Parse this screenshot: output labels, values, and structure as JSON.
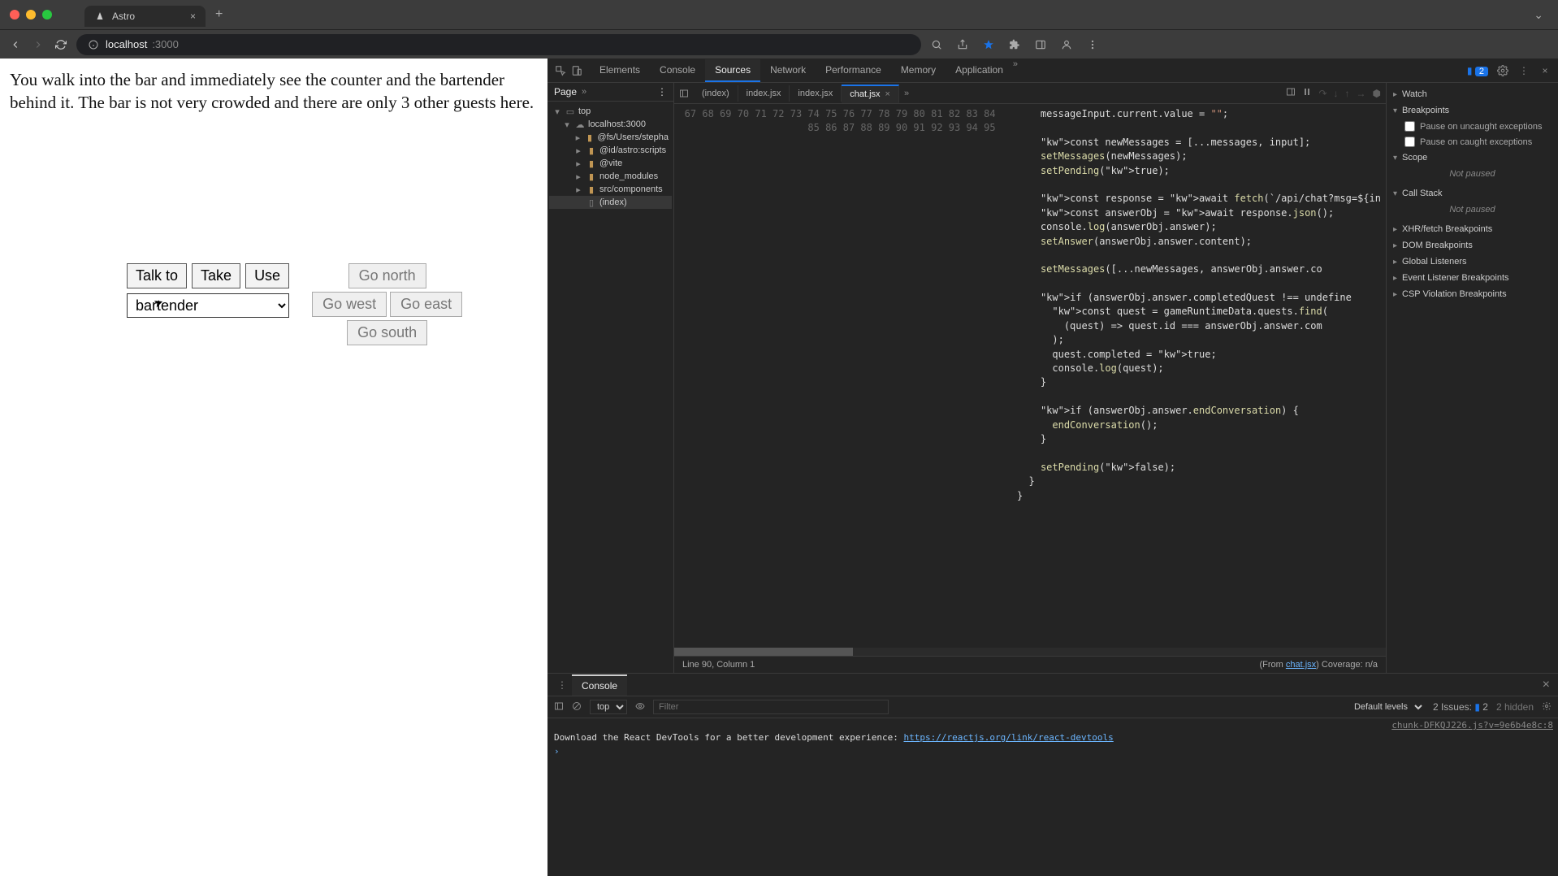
{
  "browser": {
    "tab_title": "Astro",
    "url_host": "localhost",
    "url_path": ":3000"
  },
  "game": {
    "narrative": "You walk into the bar and immediately see the counter and the bartender behind it. The bar is not very crowded and there are only 3 other guests here.",
    "actions": {
      "talk_to": "Talk to",
      "take": "Take",
      "use": "Use"
    },
    "target_selected": "bartender",
    "nav": {
      "north": "Go north",
      "west": "Go west",
      "east": "Go east",
      "south": "Go south"
    }
  },
  "devtools": {
    "tabs": {
      "elements": "Elements",
      "console": "Console",
      "sources": "Sources",
      "network": "Network",
      "performance": "Performance",
      "memory": "Memory",
      "application": "Application"
    },
    "active_tab": "Sources",
    "issue_count": "2",
    "navigator_tab": "Page",
    "filetree": {
      "top": "top",
      "origin": "localhost:3000",
      "children": [
        "@fs/Users/stepha",
        "@id/astro:scripts",
        "@vite",
        "node_modules",
        "src/components"
      ],
      "leaf": "(index)"
    },
    "open_files": [
      "(index)",
      "index.jsx",
      "index.jsx",
      "chat.jsx"
    ],
    "active_file": "chat.jsx",
    "code_lines": [
      {
        "n": 67,
        "t": "      messageInput.current.value = \"\";"
      },
      {
        "n": 68,
        "t": ""
      },
      {
        "n": 69,
        "t": "      const newMessages = [...messages, input];"
      },
      {
        "n": 70,
        "t": "      setMessages(newMessages);"
      },
      {
        "n": 71,
        "t": "      setPending(true);"
      },
      {
        "n": 72,
        "t": ""
      },
      {
        "n": 73,
        "t": "      const response = await fetch(`/api/chat?msg=${in"
      },
      {
        "n": 74,
        "t": "      const answerObj = await response.json();"
      },
      {
        "n": 75,
        "t": "      console.log(answerObj.answer);"
      },
      {
        "n": 76,
        "t": "      setAnswer(answerObj.answer.content);"
      },
      {
        "n": 77,
        "t": ""
      },
      {
        "n": 78,
        "t": "      setMessages([...newMessages, answerObj.answer.co"
      },
      {
        "n": 79,
        "t": ""
      },
      {
        "n": 80,
        "t": "      if (answerObj.answer.completedQuest !== undefine"
      },
      {
        "n": 81,
        "t": "        const quest = gameRuntimeData.quests.find("
      },
      {
        "n": 82,
        "t": "          (quest) => quest.id === answerObj.answer.com"
      },
      {
        "n": 83,
        "t": "        );"
      },
      {
        "n": 84,
        "t": "        quest.completed = true;"
      },
      {
        "n": 85,
        "t": "        console.log(quest);"
      },
      {
        "n": 86,
        "t": "      }"
      },
      {
        "n": 87,
        "t": ""
      },
      {
        "n": 88,
        "t": "      if (answerObj.answer.endConversation) {"
      },
      {
        "n": 89,
        "t": "        endConversation();"
      },
      {
        "n": 90,
        "t": "      }"
      },
      {
        "n": 91,
        "t": ""
      },
      {
        "n": 92,
        "t": "      setPending(false);"
      },
      {
        "n": 93,
        "t": "    }"
      },
      {
        "n": 94,
        "t": "  }"
      },
      {
        "n": 95,
        "t": ""
      }
    ],
    "status_left": "Line 90, Column 1",
    "status_from": "(From ",
    "status_file": "chat.jsx",
    "status_cov": " Coverage: n/a",
    "sidebar": {
      "watch": "Watch",
      "breakpoints": "Breakpoints",
      "pause_uncaught": "Pause on uncaught exceptions",
      "pause_caught": "Pause on caught exceptions",
      "scope": "Scope",
      "not_paused": "Not paused",
      "callstack": "Call Stack",
      "xhr": "XHR/fetch Breakpoints",
      "dom": "DOM Breakpoints",
      "global": "Global Listeners",
      "event": "Event Listener Breakpoints",
      "csp": "CSP Violation Breakpoints"
    }
  },
  "console": {
    "tab": "Console",
    "context": "top",
    "filter_placeholder": "Filter",
    "levels": "Default levels",
    "issues_label": "2 Issues:",
    "issues_count": "2",
    "hidden": "2 hidden",
    "meta": "chunk-DFKQJ226.js?v=9e6b4e8c:8",
    "line_prefix": "Download the React DevTools for a better development experience: ",
    "line_link": "https://reactjs.org/link/react-devtools"
  }
}
